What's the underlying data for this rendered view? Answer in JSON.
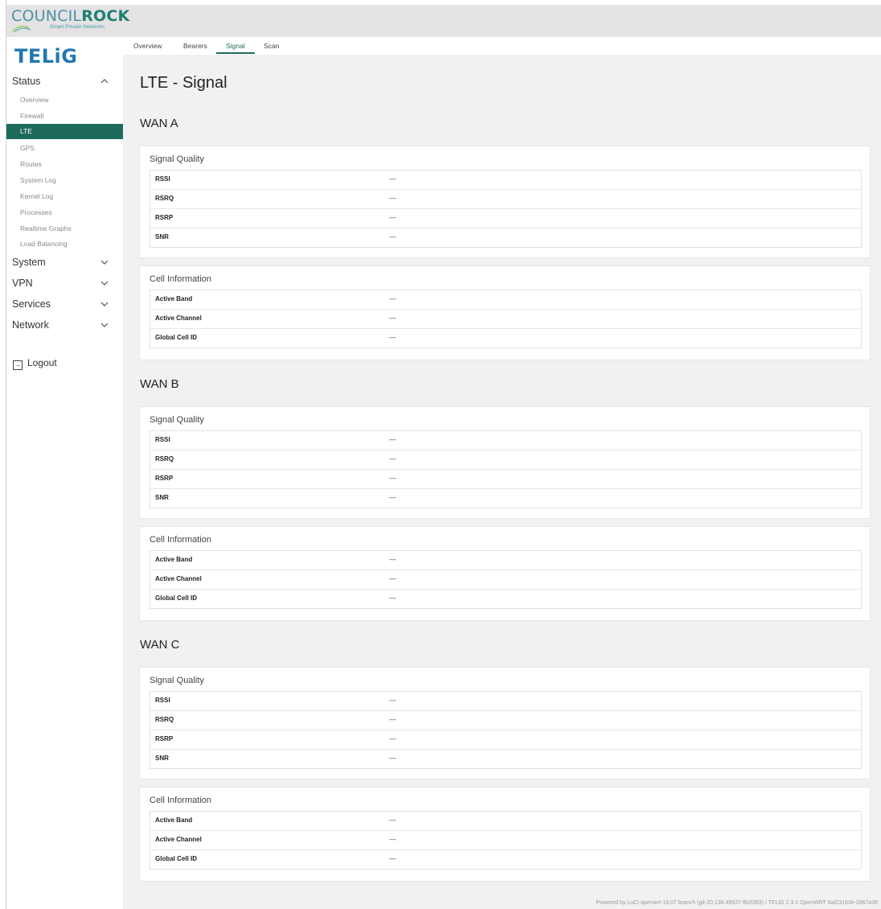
{
  "header": {
    "brand_name_part1": "COUNCIL",
    "brand_name_part2": "ROCK",
    "brand_tagline": "Smart Private Networks"
  },
  "sidebar": {
    "logo": "TELiG",
    "sections": [
      {
        "label": "Status",
        "expanded": true
      },
      {
        "label": "System",
        "expanded": false
      },
      {
        "label": "VPN",
        "expanded": false
      },
      {
        "label": "Services",
        "expanded": false
      },
      {
        "label": "Network",
        "expanded": false
      }
    ],
    "status_items": [
      "Overview",
      "Firewall",
      "LTE",
      "GPS",
      "Routes",
      "System Log",
      "Kernel Log",
      "Processes",
      "Realtime Graphs",
      "Load Balancing"
    ],
    "active_item": "LTE",
    "logout_label": "Logout"
  },
  "tabs": {
    "items": [
      "Overview",
      "Bearers",
      "Signal",
      "Scan"
    ],
    "active": "Signal"
  },
  "page": {
    "title": "LTE - Signal"
  },
  "wans": [
    {
      "title": "WAN A",
      "signal_quality": {
        "title": "Signal Quality",
        "rows": [
          {
            "label": "RSSI",
            "value": "—"
          },
          {
            "label": "RSRQ",
            "value": "—"
          },
          {
            "label": "RSRP",
            "value": "—"
          },
          {
            "label": "SNR",
            "value": "—"
          }
        ]
      },
      "cell_information": {
        "title": "Cell Information",
        "rows": [
          {
            "label": "Active Band",
            "value": "—"
          },
          {
            "label": "Active Channel",
            "value": "—"
          },
          {
            "label": "Global Cell ID",
            "value": "—"
          }
        ]
      }
    },
    {
      "title": "WAN B",
      "signal_quality": {
        "title": "Signal Quality",
        "rows": [
          {
            "label": "RSSI",
            "value": "—"
          },
          {
            "label": "RSRQ",
            "value": "—"
          },
          {
            "label": "RSRP",
            "value": "—"
          },
          {
            "label": "SNR",
            "value": "—"
          }
        ]
      },
      "cell_information": {
        "title": "Cell Information",
        "rows": [
          {
            "label": "Active Band",
            "value": "—"
          },
          {
            "label": "Active Channel",
            "value": "—"
          },
          {
            "label": "Global Cell ID",
            "value": "—"
          }
        ]
      }
    },
    {
      "title": "WAN C",
      "signal_quality": {
        "title": "Signal Quality",
        "rows": [
          {
            "label": "RSSI",
            "value": "—"
          },
          {
            "label": "RSRQ",
            "value": "—"
          },
          {
            "label": "RSRP",
            "value": "—"
          },
          {
            "label": "SNR",
            "value": "—"
          }
        ]
      },
      "cell_information": {
        "title": "Cell Information",
        "rows": [
          {
            "label": "Active Band",
            "value": "—"
          },
          {
            "label": "Active Channel",
            "value": "—"
          },
          {
            "label": "Global Cell ID",
            "value": "—"
          }
        ]
      }
    }
  ],
  "footer": {
    "text": "Powered by LuCI openwrt-19.07 branch (git-20.136.49537-fb2f363) / TELiG 2.3.1 OpenWRT 6af231fcfe-2667a38"
  },
  "colors": {
    "accent": "#1e6b5c",
    "logo_blue": "#2478ae",
    "header_bg": "#e3e3e3",
    "content_bg": "#f1f1f1"
  },
  "icons": {
    "section_expanded": "chevron-up-icon",
    "section_collapsed": "chevron-down-icon",
    "logout": "logout-icon"
  }
}
